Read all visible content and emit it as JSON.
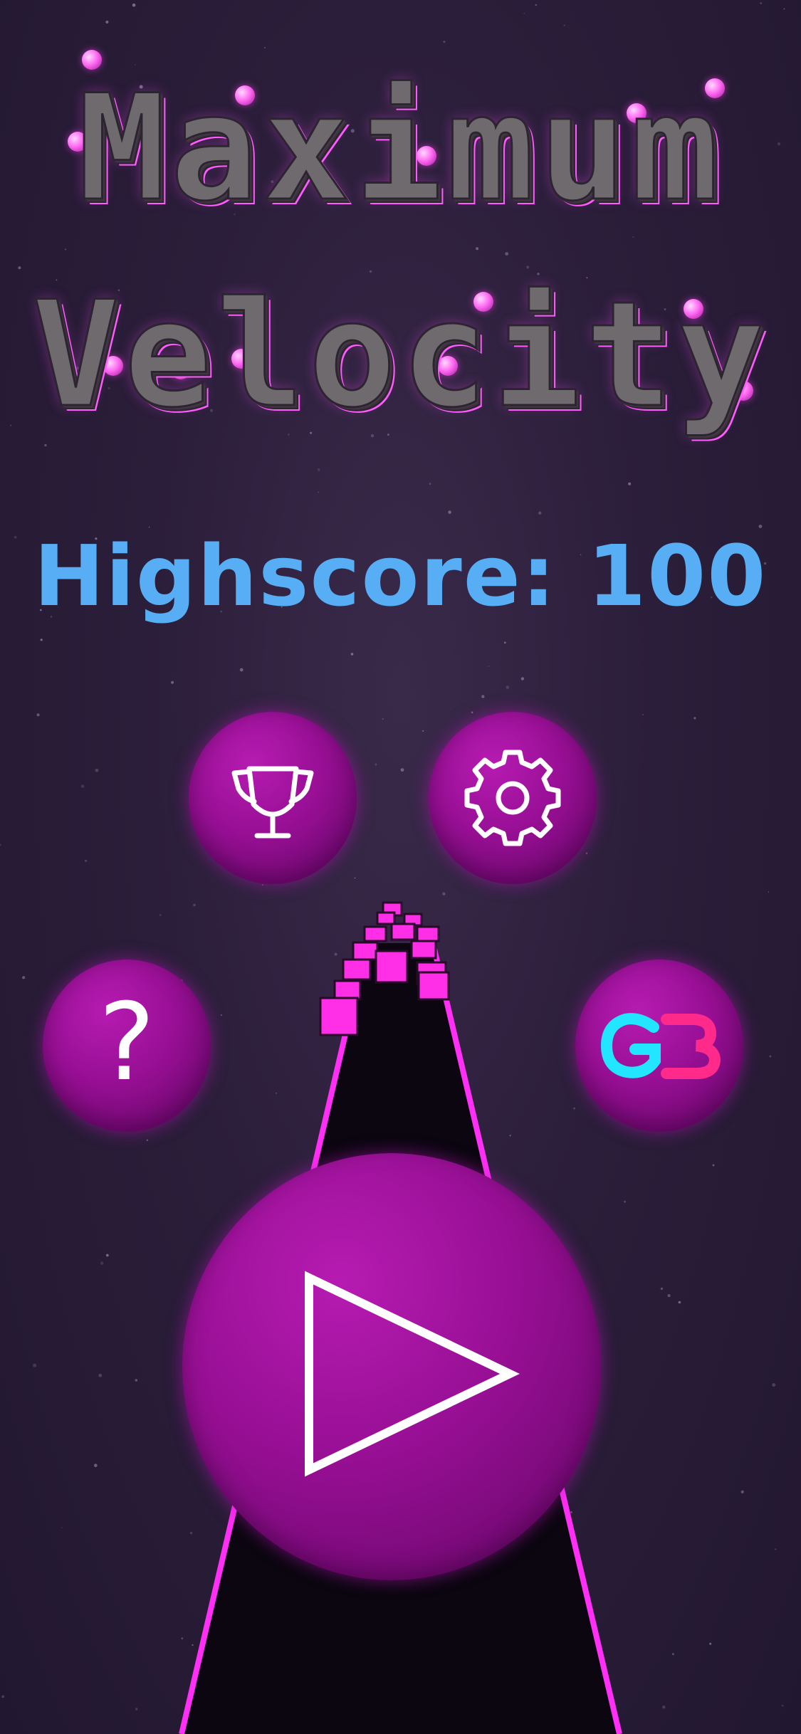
{
  "title": {
    "line1": "Maximum",
    "line2": "Velocity"
  },
  "highscore": {
    "text": "Highscore: 100"
  },
  "buttons": {
    "trophy": {
      "icon": "trophy-icon"
    },
    "settings": {
      "icon": "gear-icon"
    },
    "help": {
      "icon": "question-icon",
      "glyph": "?"
    },
    "gb": {
      "icon": "gb-logo-icon",
      "logo_text": "GB"
    },
    "play": {
      "icon": "play-icon"
    }
  },
  "colors": {
    "background": "#2b1e3a",
    "orb": "#970f94",
    "highscore": "#58aef5",
    "road_edge": "#ff2ff5",
    "gb_cyan": "#22e6ff",
    "gb_pink": "#ff2a8a"
  }
}
